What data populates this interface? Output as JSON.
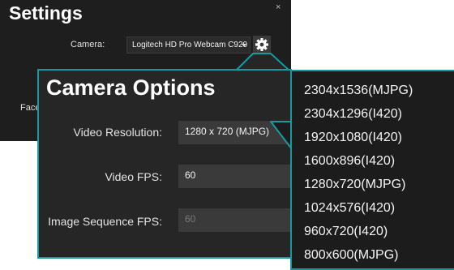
{
  "settings": {
    "title": "Settings",
    "close_glyph": "×",
    "camera_label": "Camera:",
    "camera_value": "Logitech HD Pro Webcam C920",
    "face_label": "Face"
  },
  "camera_options": {
    "title": "Camera Options",
    "fields": [
      {
        "label": "Video Resolution:",
        "value": "1280 x 720 (MJPG)"
      },
      {
        "label": "Video FPS:",
        "value": "60"
      },
      {
        "label": "Image Sequence FPS:",
        "value": "60"
      }
    ]
  },
  "resolution_options": [
    "2304x1536(MJPG)",
    "2304x1296(I420)",
    "1920x1080(I420)",
    "1600x896(I420)",
    "1280x720(MJPG)",
    "1024x576(I420)",
    "960x720(I420)",
    "800x600(MJPG)"
  ],
  "colors": {
    "accent": "#169aa0",
    "window_bg": "#1e1e1e",
    "panel_bg": "#262626",
    "field_bg": "#3a3a3a"
  },
  "icons": {
    "gear": "gear-icon",
    "dropdown": "chevron-down-icon",
    "close": "close-icon"
  }
}
